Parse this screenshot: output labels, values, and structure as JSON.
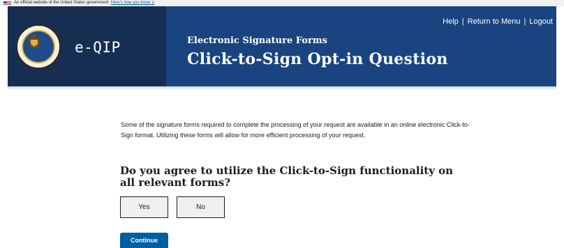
{
  "gov_banner": {
    "text": "An official website of the United States government",
    "link": "Here's how you know ∨"
  },
  "header": {
    "app_name": "e-QIP",
    "nav": {
      "help": "Help",
      "separator": "|",
      "return_to_menu": "Return to Menu",
      "logout": "Logout"
    },
    "subtitle": "Electronic Signature Forms",
    "title": "Click-to-Sign Opt-in Question"
  },
  "main": {
    "intro": "Some of the signature forms required to complete the processing of your request are available in an online electronic Click-to-Sign format. Utilizing these forms will allow for more efficient processing of your request.",
    "question": "Do you agree to utilize the Click-to-Sign functionality on all relevant forms?",
    "answers": {
      "yes": "Yes",
      "no": "No"
    },
    "continue_label": "Continue"
  },
  "colors": {
    "header_bg": "#1a4480",
    "header_left_bg": "#162e51",
    "primary_button": "#005ea2"
  }
}
